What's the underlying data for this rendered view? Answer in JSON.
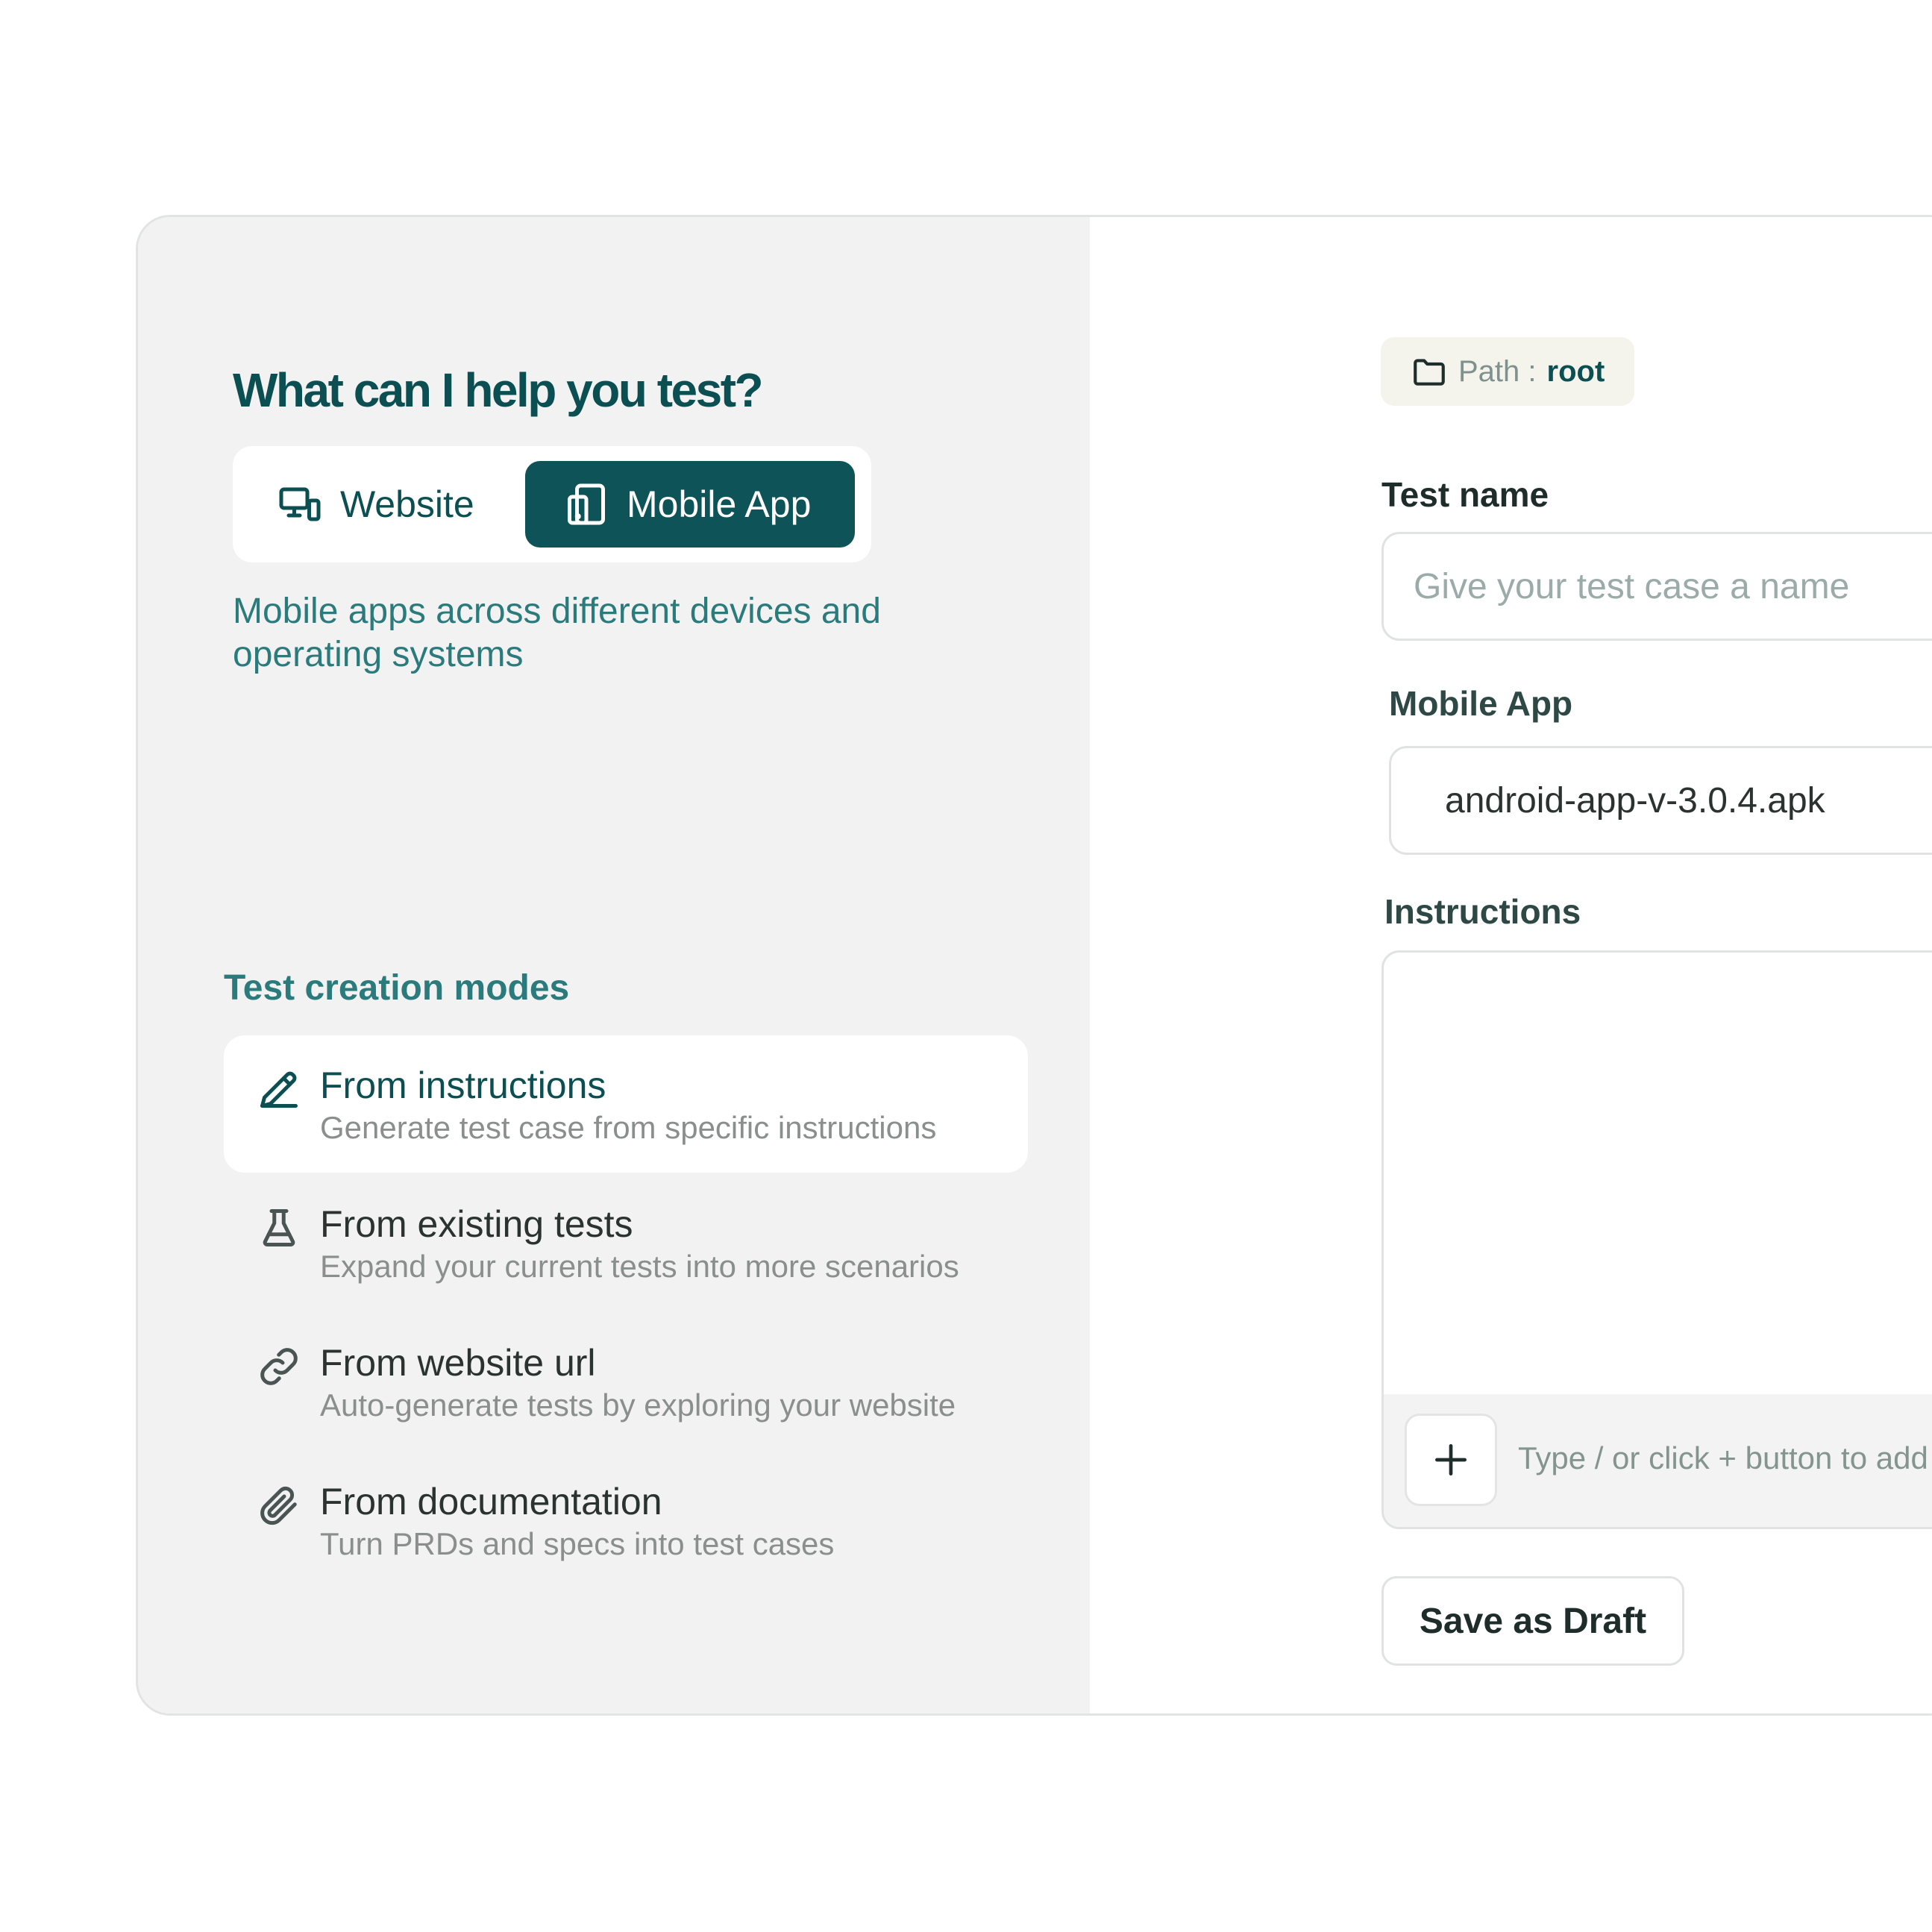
{
  "left": {
    "heading": "What can I help you test?",
    "segmented": {
      "website_label": "Website",
      "mobile_label": "Mobile App",
      "selected": "Mobile App",
      "website_icon": "devices-icon",
      "mobile_icon": "phone-tablet-icon"
    },
    "description": "Mobile apps across different devices and operating systems",
    "modes_title": "Test creation modes",
    "modes": [
      {
        "title": "From instructions",
        "subtitle": "Generate test case from specific instructions",
        "icon": "pencil-icon",
        "active": true
      },
      {
        "title": "From existing tests",
        "subtitle": "Expand your current tests into more scenarios",
        "icon": "flask-icon",
        "active": false
      },
      {
        "title": "From website url",
        "subtitle": "Auto-generate tests by exploring your website",
        "icon": "link-icon",
        "active": false
      },
      {
        "title": "From documentation",
        "subtitle": "Turn PRDs and specs into test cases",
        "icon": "paperclip-icon",
        "active": false
      }
    ]
  },
  "right": {
    "path": {
      "label": "Path :",
      "value": "root",
      "icon": "folder-icon"
    },
    "test_name": {
      "label": "Test name",
      "placeholder": "Give your test case a name",
      "value": ""
    },
    "mobile_app": {
      "label": "Mobile App",
      "value": "android-app-v-3.0.4.apk"
    },
    "instructions": {
      "label": "Instructions",
      "value": "",
      "toolbar_hint": "Type / or click + button to add elements",
      "add_icon": "plus-icon"
    },
    "save_draft_label": "Save as Draft"
  },
  "colors": {
    "brand": "#0c4f52",
    "brand_button": "#0d5357",
    "accent_text": "#2c7b7c",
    "left_panel_bg": "#f2f2f2",
    "path_chip_bg": "#f4f4ed"
  }
}
